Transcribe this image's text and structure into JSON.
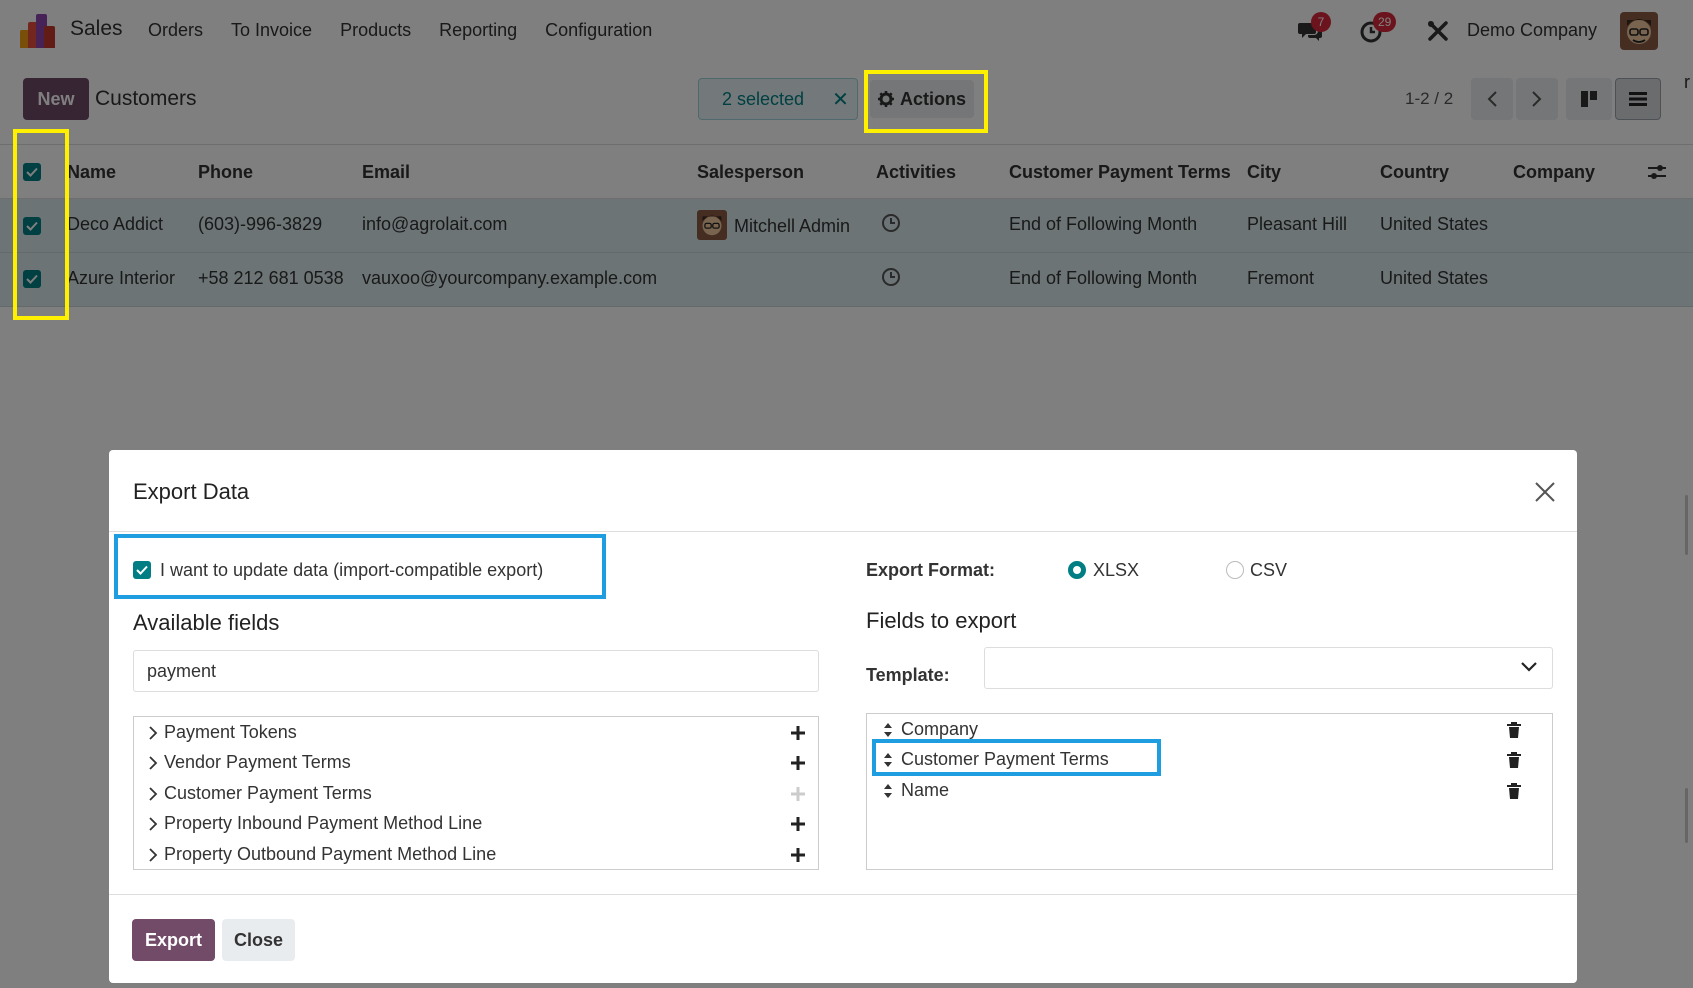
{
  "nav": {
    "app_name": "Sales",
    "menu": [
      "Orders",
      "To Invoice",
      "Products",
      "Reporting",
      "Configuration"
    ],
    "chat_count": "7",
    "activity_count": "29",
    "company": "Demo Company",
    "edge_char": "r"
  },
  "control": {
    "new_label": "New",
    "title": "Customers",
    "selected_label": "2 selected",
    "actions_label": "Actions",
    "pager": "1-2 / 2"
  },
  "list": {
    "columns": [
      "Name",
      "Phone",
      "Email",
      "Salesperson",
      "Activities",
      "Customer Payment Terms",
      "City",
      "Country",
      "Company"
    ],
    "rows": [
      {
        "name": "Deco Addict",
        "phone": "(603)-996-3829",
        "email": "info@agrolait.com",
        "salesperson": "Mitchell Admin",
        "terms": "End of Following Month",
        "city": "Pleasant Hill",
        "country": "United States",
        "company": ""
      },
      {
        "name": "Azure Interior",
        "phone": "+58 212 681 0538",
        "email": "vauxoo@yourcompany.example.com",
        "salesperson": "",
        "terms": "End of Following Month",
        "city": "Fremont",
        "country": "United States",
        "company": ""
      }
    ]
  },
  "modal": {
    "title": "Export Data",
    "import_compat_label": "I want to update data (import-compatible export)",
    "export_format_label": "Export Format:",
    "formats": [
      "XLSX",
      "CSV"
    ],
    "selected_format": "XLSX",
    "available_fields_title": "Available fields",
    "search_value": "payment",
    "available_fields": [
      "Payment Tokens",
      "Vendor Payment Terms",
      "Customer Payment Terms",
      "Property Inbound Payment Method Line",
      "Property Outbound Payment Method Line"
    ],
    "fields_to_export_title": "Fields to export",
    "template_label": "Template:",
    "export_fields": [
      "Company",
      "Customer Payment Terms",
      "Name"
    ],
    "export_button": "Export",
    "close_button": "Close"
  },
  "colors": {
    "brand": "#714b67",
    "accent": "#017e84",
    "highlight_yellow": "#fff000",
    "highlight_blue": "#1e9ee0"
  }
}
